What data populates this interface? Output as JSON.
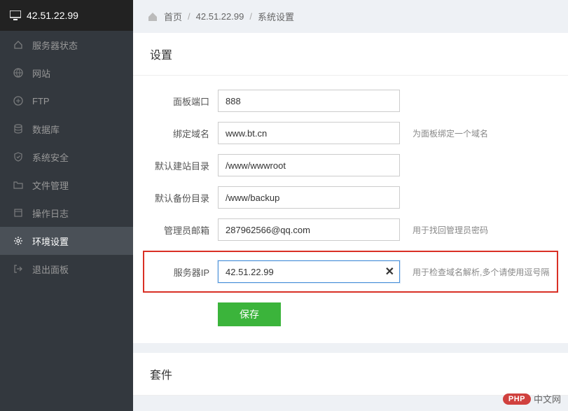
{
  "header": {
    "ip": "42.51.22.99"
  },
  "sidebar": {
    "items": [
      {
        "label": "服务器状态"
      },
      {
        "label": "网站"
      },
      {
        "label": "FTP"
      },
      {
        "label": "数据库"
      },
      {
        "label": "系统安全"
      },
      {
        "label": "文件管理"
      },
      {
        "label": "操作日志"
      },
      {
        "label": "环境设置"
      },
      {
        "label": "退出面板"
      }
    ]
  },
  "breadcrumb": {
    "home": "首页",
    "ip": "42.51.22.99",
    "current": "系统设置"
  },
  "panel": {
    "title": "设置",
    "fields": {
      "port": {
        "label": "面板端口",
        "value": "888",
        "hint": ""
      },
      "domain": {
        "label": "绑定域名",
        "value": "www.bt.cn",
        "hint": "为面板绑定一个域名"
      },
      "siteDir": {
        "label": "默认建站目录",
        "value": "/www/wwwroot",
        "hint": ""
      },
      "backupDir": {
        "label": "默认备份目录",
        "value": "/www/backup",
        "hint": ""
      },
      "adminEmail": {
        "label": "管理员邮箱",
        "value": "287962566@qq.com",
        "hint": "用于找回管理员密码"
      },
      "serverIp": {
        "label": "服务器IP",
        "value": "42.51.22.99",
        "hint": "用于检查域名解析,多个请使用逗号隔"
      }
    },
    "save": "保存"
  },
  "panel2": {
    "title": "套件"
  },
  "footer": {
    "php": "PHP",
    "text": "中文网"
  }
}
